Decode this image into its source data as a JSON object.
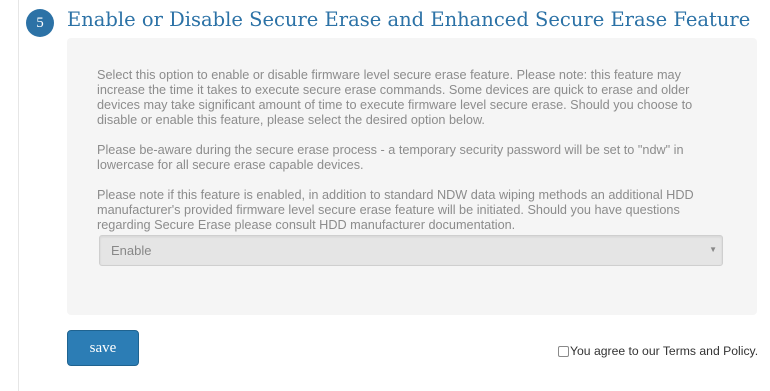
{
  "section": {
    "step_number": "5",
    "title": "Enable or Disable Secure Erase and Enhanced Secure Erase Feature"
  },
  "panel": {
    "paragraphs": [
      "Select this option to enable or disable firmware level secure erase feature. Please note: this feature may increase the time it takes to execute secure erase commands. Some devices are quick to erase and older devices may take significant amount of time to execute firmware level secure erase. Should you choose to disable or enable this feature, please select the desired option below.",
      "Please be-aware during the secure erase process - a temporary security password will be set to \"ndw\" in lowercase for all secure erase capable devices.",
      "Please note if this feature is enabled, in addition to standard NDW data wiping methods an additional HDD manufacturer's provided firmware level secure erase feature will be initiated. Should you have questions regarding Secure Erase please consult HDD manufacturer documentation."
    ],
    "select": {
      "selected": "Enable",
      "arrow": "▼"
    }
  },
  "actions": {
    "save_label": "save",
    "terms_label": "You agree to our Terms and Policy.",
    "terms_checked": false
  },
  "colors": {
    "accent": "#2c72a6",
    "panel_bg": "#f5f5f5",
    "body_text": "#8c8c8c"
  }
}
